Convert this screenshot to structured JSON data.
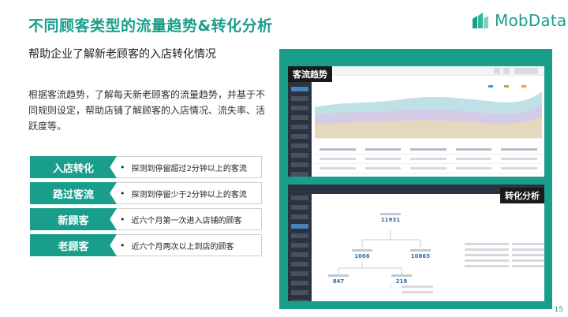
{
  "slide": {
    "title": "不同顾客类型的流量趋势&转化分析",
    "subtitle": "帮助企业了解新老顾客的入店转化情况",
    "description": "根据客流趋势，了解每天新老顾客的流量趋势，并基于不同规则设定，帮助店铺了解顾客的入店情况、流失率、活跃度等。",
    "page_number": "15",
    "accent_color": "#1a9e8c"
  },
  "logo": {
    "text": "MobData",
    "icon": "building-blocks-icon"
  },
  "definitions": [
    {
      "label": "入店转化",
      "bullet": "•",
      "text": "探测到停留超过2分钟以上的客流"
    },
    {
      "label": "路过客流",
      "bullet": "•",
      "text": "探测到停留少于2分钟以上的客流"
    },
    {
      "label": "新顾客",
      "bullet": "•",
      "text": "近六个月第一次进入店铺的顾客"
    },
    {
      "label": "老顾客",
      "bullet": "•",
      "text": "近六个月两次以上到店的顾客"
    }
  ],
  "screenshots": {
    "trend": {
      "tag": "客流趋势"
    },
    "conversion": {
      "tag": "转化分析",
      "values": {
        "total": "11931",
        "left": "1066",
        "right": "10865",
        "bottom_left": "847",
        "bottom_right": "219"
      }
    }
  }
}
